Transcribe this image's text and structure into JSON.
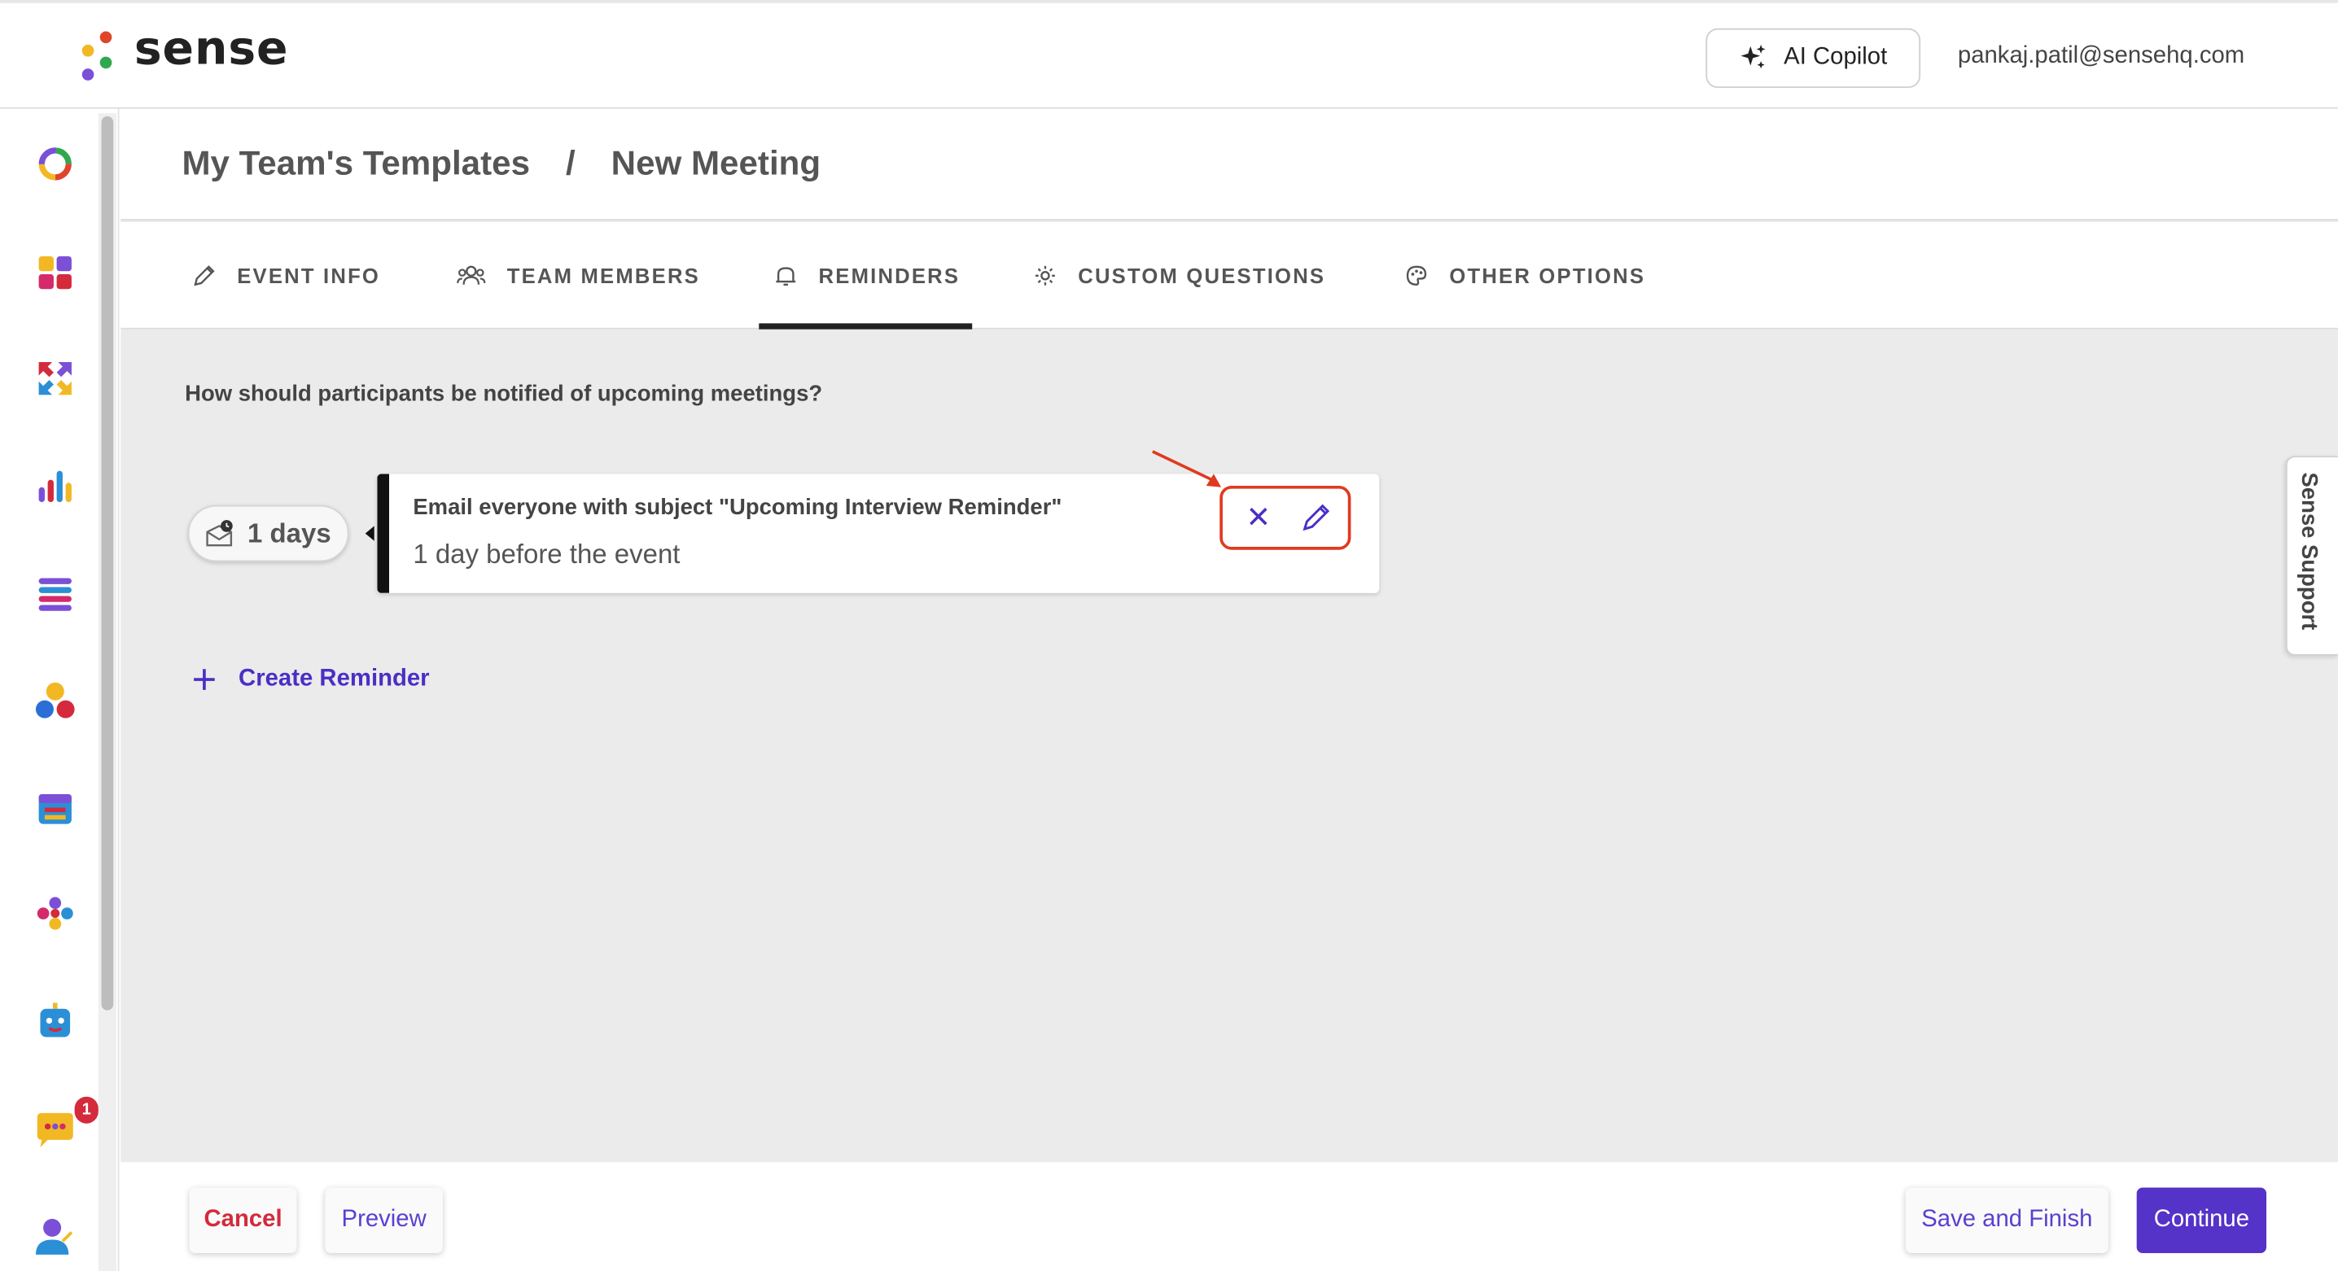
{
  "app": {
    "logo_text": "sense",
    "copilot_label": "AI Copilot",
    "user_email": "pankaj.patil@sensehq.com"
  },
  "breadcrumb": {
    "parent": "My Team's Templates",
    "separator": "/",
    "current": "New Meeting"
  },
  "tabs": [
    {
      "label": "EVENT INFO",
      "icon": "pencil-icon"
    },
    {
      "label": "TEAM MEMBERS",
      "icon": "people-icon"
    },
    {
      "label": "REMINDERS",
      "icon": "bell-icon",
      "active": true
    },
    {
      "label": "CUSTOM QUESTIONS",
      "icon": "gear-icon"
    },
    {
      "label": "OTHER OPTIONS",
      "icon": "palette-icon"
    }
  ],
  "reminders": {
    "question": "How should participants be notified of upcoming meetings?",
    "items": [
      {
        "days_label": "1 days",
        "title": "Email everyone with subject \"Upcoming Interview Reminder\"",
        "subtitle": "1 day before the event"
      }
    ],
    "create_label": "Create Reminder"
  },
  "support": {
    "label": "Sense Support"
  },
  "sidebar": {
    "notification_count": "1"
  },
  "footer": {
    "cancel": "Cancel",
    "preview": "Preview",
    "save_finish": "Save and Finish",
    "continue": "Continue"
  },
  "colors": {
    "accent": "#5532c8",
    "danger": "#d42a3c",
    "annotation": "#e03a1e"
  }
}
